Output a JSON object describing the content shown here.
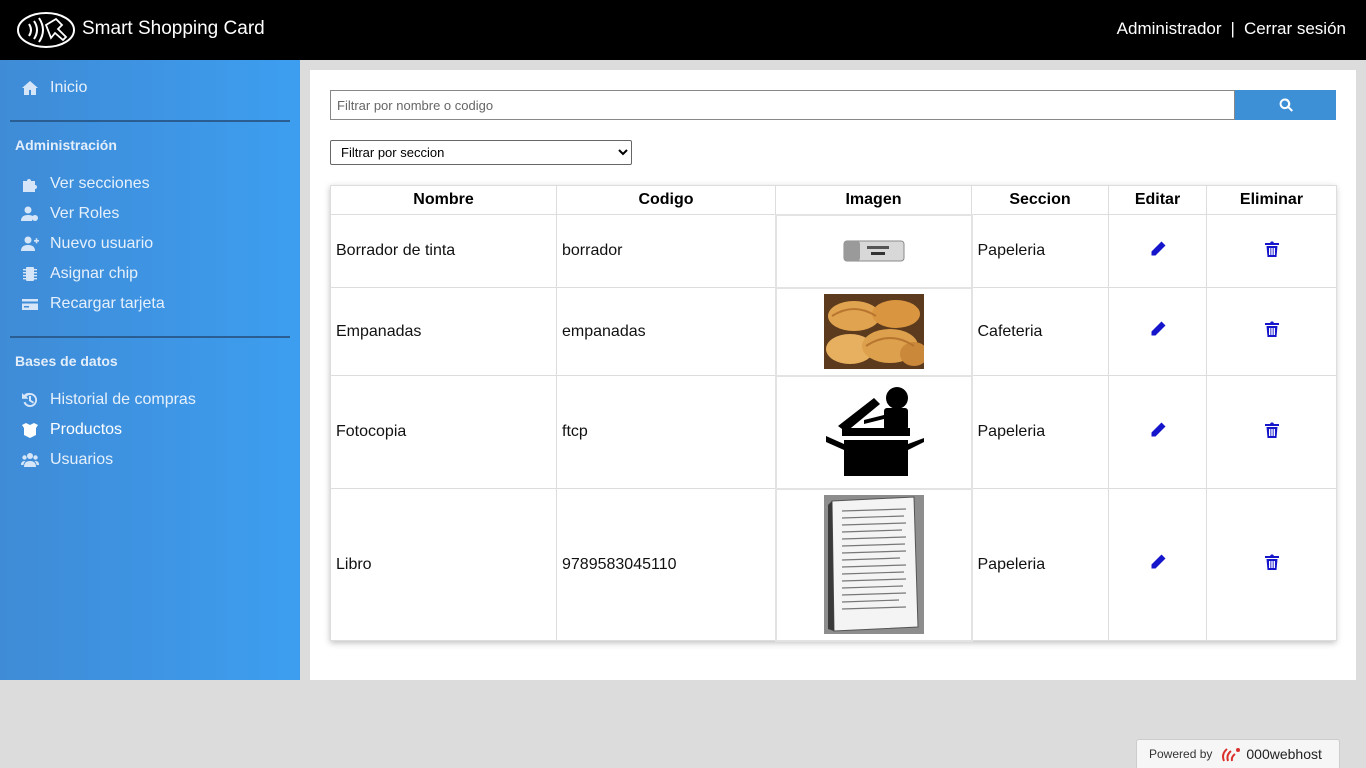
{
  "header": {
    "app_title": "Smart Shopping Card",
    "user_name": "Administrador",
    "separator": "|",
    "logout": "Cerrar sesión"
  },
  "sidebar": {
    "home": "Inicio",
    "admin_heading": "Administración",
    "admin_items": [
      "Ver secciones",
      "Ver Roles",
      "Nuevo usuario",
      "Asignar chip",
      "Recargar tarjeta"
    ],
    "db_heading": "Bases de datos",
    "db_items": [
      "Historial de compras",
      "Productos",
      "Usuarios"
    ],
    "active_item": "Productos"
  },
  "main": {
    "search_placeholder": "Filtrar por nombre o codigo",
    "section_filter": "Filtrar por seccion",
    "columns": [
      "Nombre",
      "Codigo",
      "Imagen",
      "Seccion",
      "Editar",
      "Eliminar"
    ],
    "rows": [
      {
        "nombre": "Borrador de tinta",
        "codigo": "borrador",
        "seccion": "Papeleria"
      },
      {
        "nombre": "Empanadas",
        "codigo": "empanadas",
        "seccion": "Cafeteria"
      },
      {
        "nombre": "Fotocopia",
        "codigo": "ftcp",
        "seccion": "Papeleria"
      },
      {
        "nombre": "Libro",
        "codigo": "9789583045110",
        "seccion": "Papeleria"
      }
    ]
  },
  "footer": {
    "powered_by": "Powered by",
    "host_brand": "000webhost"
  },
  "colors": {
    "header_bg": "#000000",
    "sidebar_gradient": [
      "#3f8bd6",
      "#3d9ef0"
    ],
    "accent_button": "#3d8fd6",
    "action_icon": "#1515cc"
  }
}
